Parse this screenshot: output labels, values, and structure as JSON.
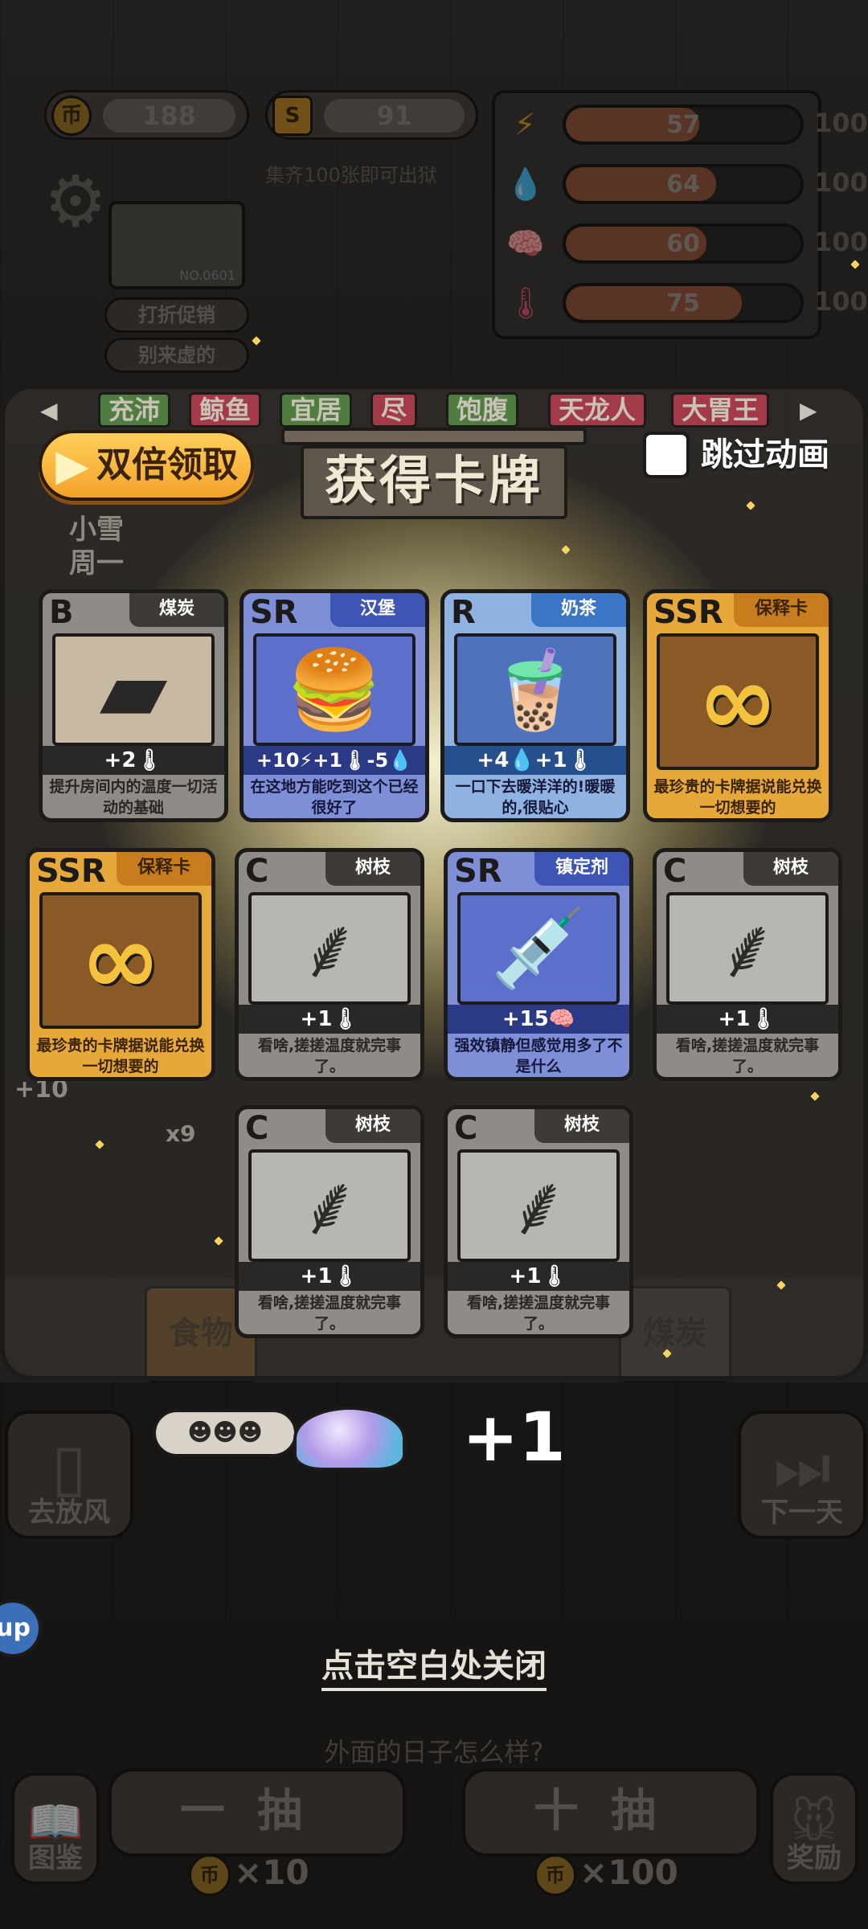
{
  "resources": {
    "coins": "188",
    "s_currency": "91",
    "collect_hint": "集齐100张即可出狱"
  },
  "profile": {
    "id": "NO.0601"
  },
  "side_buttons": {
    "discount": "打折促销",
    "no_fake": "别来虚的"
  },
  "stats": [
    {
      "icon": "lightning-icon",
      "glyph": "⚡",
      "value": "57",
      "max": "100",
      "level": 0.57,
      "color": "#e1a12a"
    },
    {
      "icon": "water-drop-icon",
      "glyph": "💧",
      "value": "64",
      "max": "100",
      "level": 0.64,
      "color": "#4aa8e8"
    },
    {
      "icon": "brain-icon",
      "glyph": "🧠",
      "value": "60",
      "max": "100",
      "level": 0.6,
      "color": "#9a7ad8"
    },
    {
      "icon": "thermometer-icon",
      "glyph": "🌡",
      "value": "75",
      "max": "100",
      "level": 0.75,
      "color": "#e05a7a"
    }
  ],
  "tabs": [
    {
      "label": "充沛",
      "color": "#4f7d3f"
    },
    {
      "label": "鲸鱼",
      "color": "#a33a48"
    },
    {
      "label": "宜居",
      "color": "#4f7d3f"
    },
    {
      "label": "尽",
      "color": "#a33a48"
    },
    {
      "label": "饱腹",
      "color": "#4f7d3f"
    },
    {
      "label": "天龙人",
      "color": "#a33a48"
    },
    {
      "label": "大胃王",
      "color": "#a33a48"
    }
  ],
  "popup": {
    "double_claim": "双倍领取",
    "title": "获得卡牌",
    "skip_animation": "跳过动画",
    "close_hint": "点击空白处关闭"
  },
  "cards": [
    {
      "rarity": "B",
      "name": "煤炭",
      "effect": "+2🌡",
      "desc": "提升房间内的温度一切活动的基础",
      "icon": "coal-icon",
      "glyph": "▰"
    },
    {
      "rarity": "SR",
      "name": "汉堡",
      "effect": "+10⚡+1🌡-5💧",
      "desc": "在这地方能吃到这个已经很好了",
      "icon": "burger-icon",
      "glyph": "🍔"
    },
    {
      "rarity": "R",
      "name": "奶茶",
      "effect": "+4💧+1🌡",
      "desc": "一口下去暖洋洋的!暖暖的,很贴心",
      "icon": "milk-tea-icon",
      "glyph": "🧋"
    },
    {
      "rarity": "SSR",
      "name": "保释卡",
      "effect": "",
      "desc": "最珍贵的卡牌据说能兑换一切想要的",
      "icon": "infinity-icon",
      "glyph": "∞"
    },
    {
      "rarity": "SSR",
      "name": "保释卡",
      "effect": "",
      "desc": "最珍贵的卡牌据说能兑换一切想要的",
      "icon": "infinity-icon",
      "glyph": "∞"
    },
    {
      "rarity": "C",
      "name": "树枝",
      "effect": "+1🌡",
      "desc": "看啥,搓搓温度就完事了。",
      "icon": "twig-icon",
      "glyph": "⸙"
    },
    {
      "rarity": "SR",
      "name": "镇定剂",
      "effect": "+15🧠",
      "desc": "强效镇静但感觉用多了不是什么",
      "icon": "syringe-icon",
      "glyph": "💉"
    },
    {
      "rarity": "C",
      "name": "树枝",
      "effect": "+1🌡",
      "desc": "看啥,搓搓温度就完事了。",
      "icon": "twig-icon",
      "glyph": "⸙"
    },
    {
      "rarity": "C",
      "name": "树枝",
      "effect": "+1🌡",
      "desc": "看啥,搓搓温度就完事了。",
      "icon": "twig-icon",
      "glyph": "⸙"
    },
    {
      "rarity": "C",
      "name": "树枝",
      "effect": "+1🌡",
      "desc": "看啥,搓搓温度就完事了。",
      "icon": "twig-icon",
      "glyph": "⸙"
    }
  ],
  "reward": {
    "amount": "+1"
  },
  "background": {
    "category_food": "食物",
    "category_coal": "煤炭",
    "go_out": "去放风",
    "next_day": "下一天",
    "outside_question": "外面的日子怎么样?",
    "draw_one": "一抽",
    "draw_ten": "十抽",
    "cost_one": "×10",
    "cost_ten": "×100",
    "guidebook": "图鉴",
    "rewards": "奖励",
    "help": "up",
    "behind_popup": {
      "weather": "小雪",
      "weekday": "周一",
      "partial": "+10",
      "count": "x9"
    }
  }
}
